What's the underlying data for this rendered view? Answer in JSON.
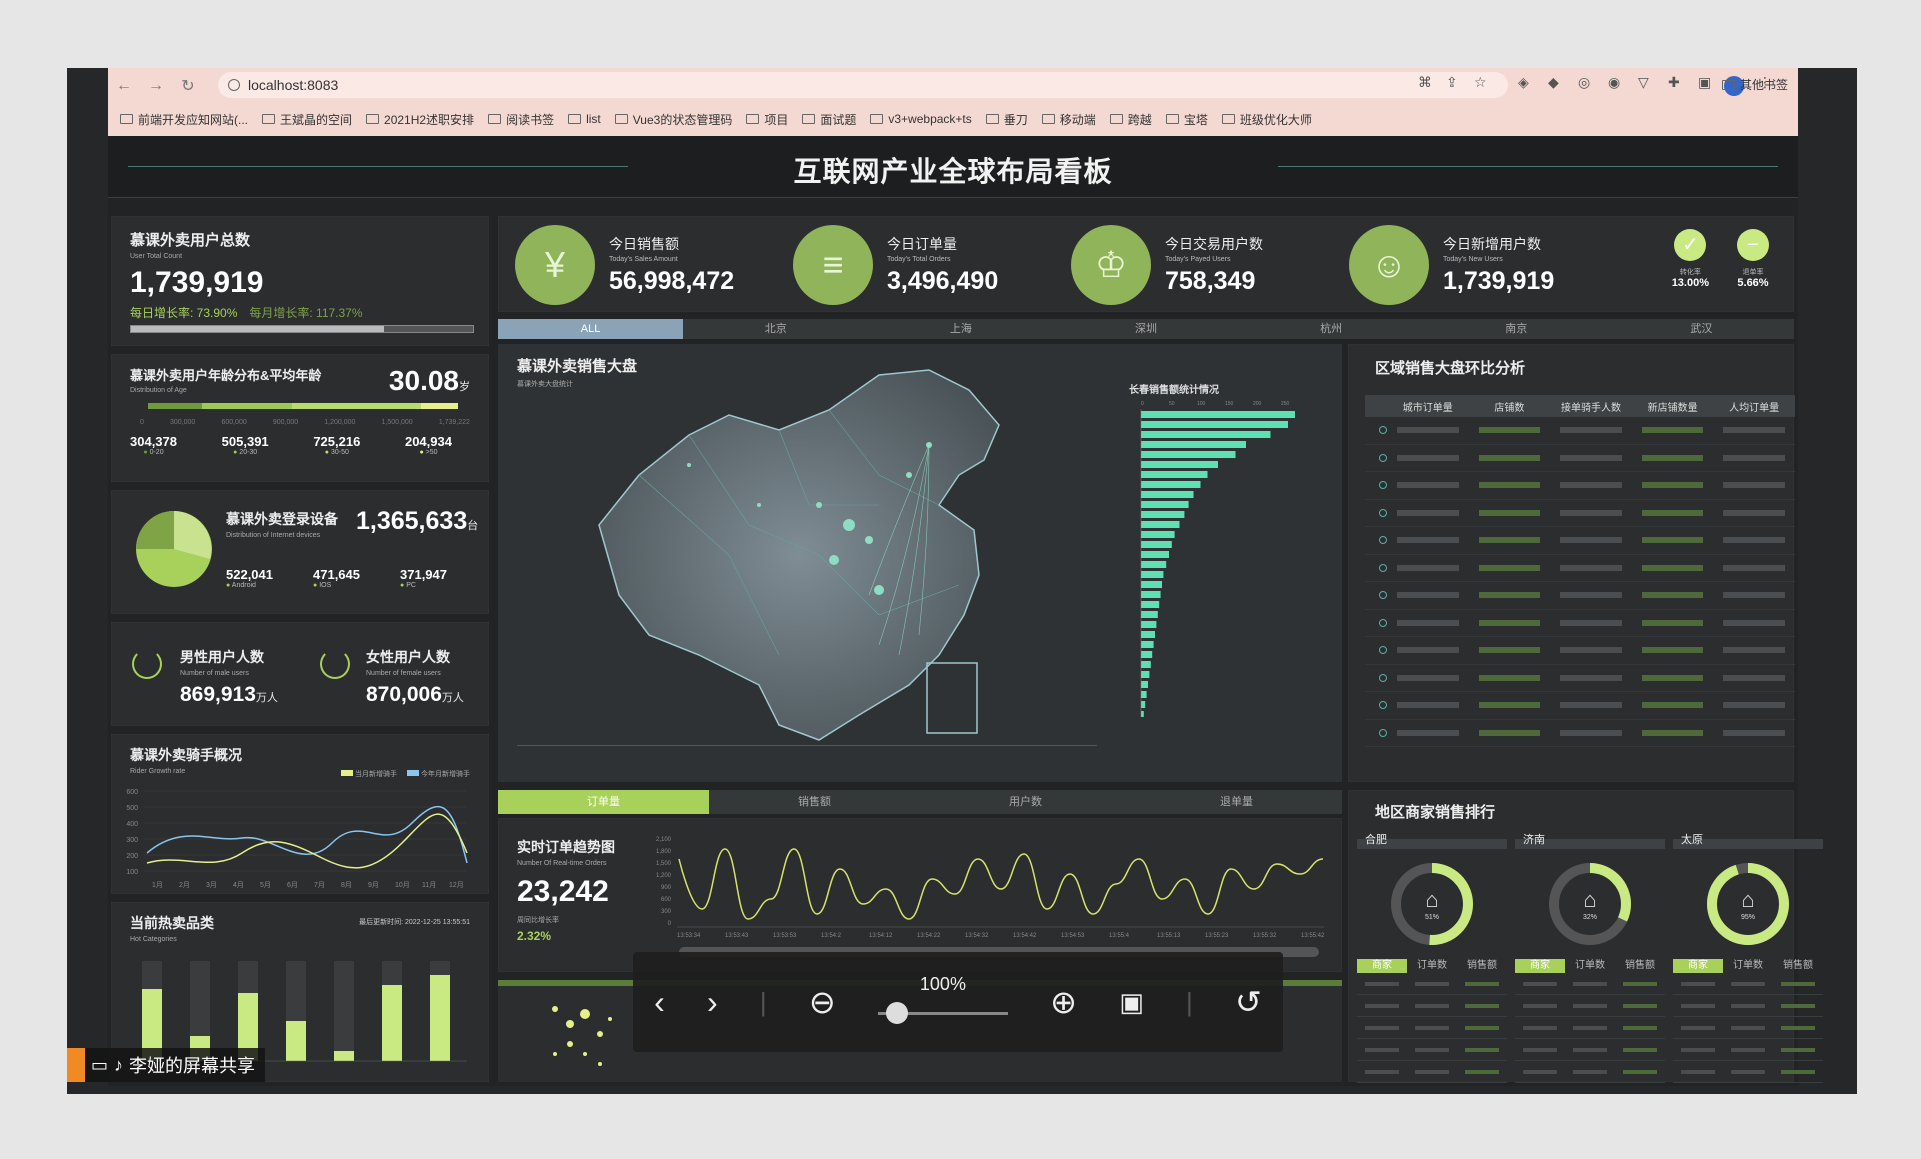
{
  "browser": {
    "url": "localhost:8083",
    "bookmarks": [
      "前端开发应知网站(...",
      "王斌晶的空间",
      "2021H2述职安排",
      "阅读书签",
      "list",
      "Vue3的状态管理码",
      "项目",
      "面试题",
      "v3+webpack+ts",
      "垂刀",
      "移动端",
      "跨越",
      "宝塔",
      "班级优化大师"
    ],
    "other_bookmarks": "其他书签"
  },
  "dashboard": {
    "title": "互联网产业全球布局看板",
    "users": {
      "title": "慕课外卖用户总数",
      "sub": "User Total Count",
      "value": "1,739,919",
      "daily": "每日增长率: 73.90%",
      "monthly": "每月增长率: 117.37%",
      "progress": 0.74
    },
    "age": {
      "title": "慕课外卖用户年龄分布&平均年龄",
      "sub": "Distribution of Age",
      "avg": "30.08",
      "unit": "岁",
      "ticks": [
        "0",
        "300,000",
        "600,000",
        "900,000",
        "1,200,000",
        "1,500,000",
        "1,739,222"
      ],
      "groups": [
        {
          "v": "304,378",
          "l": "0-20"
        },
        {
          "v": "505,391",
          "l": "20-30"
        },
        {
          "v": "725,216",
          "l": "30-50"
        },
        {
          "v": "204,934",
          "l": ">50"
        }
      ]
    },
    "devices": {
      "title": "慕课外卖登录设备",
      "sub": "Distribution of Internet devices",
      "value": "1,365,633",
      "unit": "台",
      "items": [
        {
          "v": "522,041",
          "l": "Android"
        },
        {
          "v": "471,645",
          "l": "IOS"
        },
        {
          "v": "371,947",
          "l": "PC"
        }
      ]
    },
    "gender": {
      "male_title": "男性用户人数",
      "male_sub": "Number of male users",
      "male_value": "869,913",
      "male_unit": "万人",
      "female_title": "女性用户人数",
      "female_sub": "Number of female users",
      "female_value": "870,006",
      "female_unit": "万人"
    },
    "rider": {
      "title": "慕课外卖骑手概况",
      "sub": "Rider Growth rate",
      "legend1": "当月新增骑手",
      "legend2": "今年月新增骑手",
      "yticks": [
        "600",
        "500",
        "400",
        "300",
        "200",
        "100"
      ],
      "xticks": [
        "1月",
        "2月",
        "3月",
        "4月",
        "5月",
        "6月",
        "7月",
        "8月",
        "9月",
        "10月",
        "11月",
        "12月"
      ]
    },
    "hot": {
      "title": "当前热卖品类",
      "sub": "Hot Categories",
      "update": "最后更新时间: 2022-12-25 13:55:51"
    },
    "kpis": [
      {
        "label": "今日销售额",
        "sub": "Today's Sales Amount",
        "value": "56,998,472",
        "icon": "¥"
      },
      {
        "label": "今日订单量",
        "sub": "Today's Total Orders",
        "value": "3,496,490",
        "icon": "≡"
      },
      {
        "label": "今日交易用户数",
        "sub": "Today's Payed Users",
        "value": "758,349",
        "icon": "♔"
      },
      {
        "label": "今日新增用户数",
        "sub": "Today's New Users",
        "value": "1,739,919",
        "icon": "☺"
      }
    ],
    "rates": [
      {
        "l": "转化率",
        "v": "13.00%",
        "icon": "✓"
      },
      {
        "l": "退单率",
        "v": "5.66%",
        "icon": "−"
      }
    ],
    "city_tabs": [
      "ALL",
      "北京",
      "上海",
      "深圳",
      "杭州",
      "南京",
      "武汉"
    ],
    "map": {
      "title": "慕课外卖销售大盘",
      "sub": "慕课外卖大盘统计",
      "bar_title": "长春销售额统计情况",
      "bar_ticks": [
        "0",
        "50",
        "100",
        "150",
        "200",
        "250"
      ]
    },
    "region": {
      "title": "区域销售大盘环比分析",
      "headers": [
        "城市订单量",
        "店铺数",
        "接单骑手人数",
        "新店铺数量",
        "人均订单量"
      ]
    },
    "bottom_tabs": [
      "订单量",
      "销售额",
      "用户数",
      "退单量"
    ],
    "realtime": {
      "title": "实时订单趋势图",
      "sub": "Number Of Real-time Orders",
      "value": "23,242",
      "rate_label": "周同比增长率",
      "rate": "2.32%",
      "yticks": [
        "2,100",
        "1,800",
        "1,500",
        "1,200",
        "900",
        "600",
        "300",
        "0"
      ],
      "xticks": [
        "13:53:34",
        "13:53:43",
        "13:53:53",
        "13:54:2",
        "13:54:12",
        "13:54:22",
        "13:54:32",
        "13:54:42",
        "13:54:53",
        "13:55:4",
        "13:55:13",
        "13:55:23",
        "13:55:32",
        "13:55:42"
      ]
    },
    "merchant": {
      "title": "地区商家销售排行",
      "cities": [
        {
          "name": "合肥",
          "pct": "51%"
        },
        {
          "name": "济南",
          "pct": "32%"
        },
        {
          "name": "太原",
          "pct": "95%"
        }
      ],
      "cols": [
        "商家",
        "订单数",
        "销售额"
      ]
    }
  },
  "share": {
    "label": "李娅的屏幕共享"
  },
  "viewer": {
    "zoom": "100%"
  }
}
